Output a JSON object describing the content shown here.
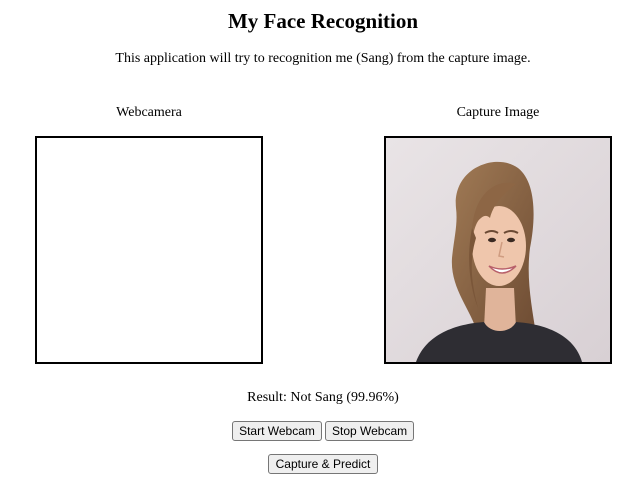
{
  "page": {
    "title": "My Face Recognition",
    "description": "This application will try to recognition me (Sang) from the capture image."
  },
  "webcam": {
    "label": "Webcamera"
  },
  "capture": {
    "label": "Capture Image"
  },
  "result": {
    "text": "Result: Not Sang (99.96%)"
  },
  "controls": {
    "start_label": "Start Webcam",
    "stop_label": "Stop Webcam",
    "capture_label": "Capture & Predict"
  }
}
